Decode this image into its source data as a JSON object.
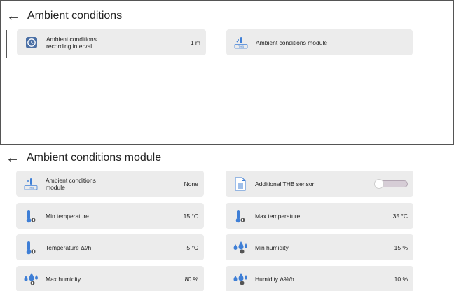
{
  "top": {
    "title": "Ambient conditions",
    "tiles": [
      {
        "label": "Ambient conditions\nrecording interval",
        "value": "1 m",
        "icon": "clock-icon"
      },
      {
        "label": "Ambient conditions module",
        "value": "",
        "icon": "thb-module-icon"
      }
    ]
  },
  "bottom": {
    "title": "Ambient conditions module",
    "tiles": [
      {
        "label": "Ambient conditions\nmodule",
        "value": "None",
        "icon": "thb-module-icon"
      },
      {
        "label": "Additional THB sensor",
        "toggle": false,
        "icon": "document-icon"
      },
      {
        "label": "Min temperature",
        "value": "15 °C",
        "icon": "thermometer-icon"
      },
      {
        "label": "Max temperature",
        "value": "35 °C",
        "icon": "thermometer-icon"
      },
      {
        "label": "Temperature Δt/h",
        "value": "5 °C",
        "icon": "thermometer-icon"
      },
      {
        "label": "Min humidity",
        "value": "15 %",
        "icon": "humidity-drops-icon"
      },
      {
        "label": "Max humidity",
        "value": "80 %",
        "icon": "humidity-drops-icon"
      },
      {
        "label": "Humidity Δ%/h",
        "value": "10 %",
        "icon": "humidity-drops-icon"
      }
    ]
  },
  "colors": {
    "tile_bg": "#ececec",
    "icon_blue": "#3f7fd6",
    "toggle_track": "#d6cdd6"
  }
}
